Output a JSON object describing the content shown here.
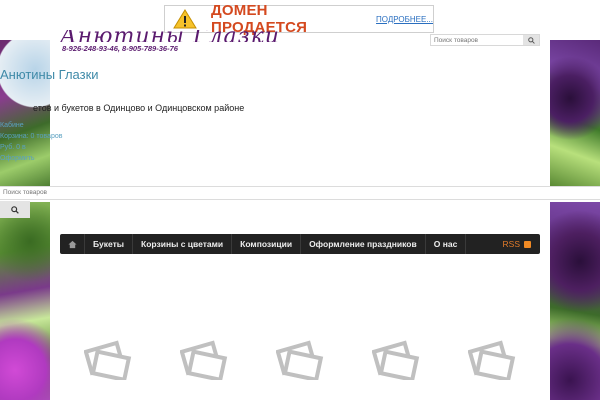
{
  "banner": {
    "title": "ДОМЕН ПРОДАЕТСЯ",
    "more_link": "ПОДРОБНЕЕ..."
  },
  "header": {
    "logo_text": "Анютины Глазки",
    "phones": "8-926-248-93-46, 8-905-789-36-76",
    "search_placeholder": "Поиск товаров"
  },
  "site": {
    "title": "Анютины Глазки",
    "tagline": "етов и букетов в Одинцово и Одинцовском районе"
  },
  "cart": {
    "cabinet": "Кабине",
    "cart_count": "Корзина: 0 товаров",
    "total": "Руб. 0 в",
    "checkout": "Оформить"
  },
  "search": {
    "placeholder": "Поиск товаров"
  },
  "nav": {
    "items": [
      "Букеты",
      "Корзины с цветами",
      "Композиции",
      "Оформление праздников",
      "О нас"
    ],
    "rss": "RSS"
  },
  "colors": {
    "accent_link": "#3f8aa8",
    "brand_purple": "#5a1a6e",
    "banner_red": "#d4491f",
    "navbar": "#222222",
    "rss_orange": "#f08a24"
  },
  "icons": {
    "banner": "warning-icon",
    "nav_home": "home-icon",
    "search": "search-icon",
    "rss": "rss-icon",
    "placeholder": "image-placeholder-icon"
  }
}
